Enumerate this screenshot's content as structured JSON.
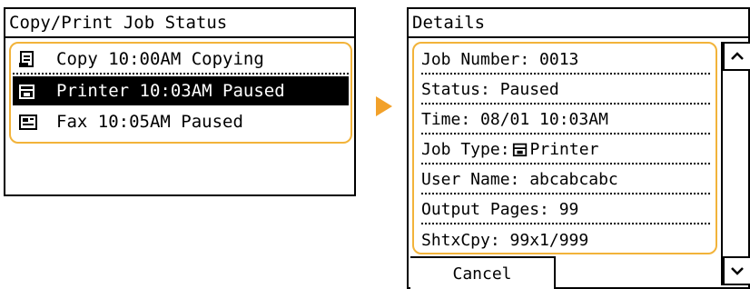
{
  "job_status_screen": {
    "title": "Copy/Print Job Status",
    "jobs": [
      {
        "icon": "copy-job-icon",
        "label": "Copy 10:00AM Copying",
        "selected": false
      },
      {
        "icon": "printer-job-icon",
        "label": "Printer 10:03AM Paused",
        "selected": true
      },
      {
        "icon": "fax-job-icon",
        "label": "Fax 10:05AM Paused",
        "selected": false
      }
    ]
  },
  "transition_arrow": {
    "icon": "right-arrow-icon",
    "color": "#f2a12a"
  },
  "details_screen": {
    "title": "Details",
    "fields": [
      "Job Number: 0013",
      "Status: Paused",
      "Time: 08/01 10:03AM",
      "User Name: abcabcabc",
      "Output Pages: 99",
      "ShtxCpy: 99x1/999"
    ],
    "job_type_label": "Job Type:",
    "job_type_value": "Printer",
    "job_type_icon": "printer-job-icon",
    "cancel_label": "Cancel",
    "scroll_up_icon": "chevron-up-icon",
    "scroll_down_icon": "chevron-down-icon"
  },
  "highlight_color": "#f2b33a"
}
